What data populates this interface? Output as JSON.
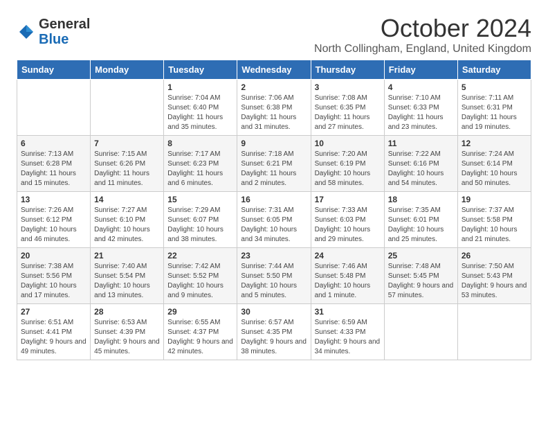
{
  "header": {
    "logo_general": "General",
    "logo_blue": "Blue",
    "month_title": "October 2024",
    "subtitle": "North Collingham, England, United Kingdom"
  },
  "weekdays": [
    "Sunday",
    "Monday",
    "Tuesday",
    "Wednesday",
    "Thursday",
    "Friday",
    "Saturday"
  ],
  "weeks": [
    [
      {
        "day": "",
        "sunrise": "",
        "sunset": "",
        "daylight": ""
      },
      {
        "day": "",
        "sunrise": "",
        "sunset": "",
        "daylight": ""
      },
      {
        "day": "1",
        "sunrise": "Sunrise: 7:04 AM",
        "sunset": "Sunset: 6:40 PM",
        "daylight": "Daylight: 11 hours and 35 minutes."
      },
      {
        "day": "2",
        "sunrise": "Sunrise: 7:06 AM",
        "sunset": "Sunset: 6:38 PM",
        "daylight": "Daylight: 11 hours and 31 minutes."
      },
      {
        "day": "3",
        "sunrise": "Sunrise: 7:08 AM",
        "sunset": "Sunset: 6:35 PM",
        "daylight": "Daylight: 11 hours and 27 minutes."
      },
      {
        "day": "4",
        "sunrise": "Sunrise: 7:10 AM",
        "sunset": "Sunset: 6:33 PM",
        "daylight": "Daylight: 11 hours and 23 minutes."
      },
      {
        "day": "5",
        "sunrise": "Sunrise: 7:11 AM",
        "sunset": "Sunset: 6:31 PM",
        "daylight": "Daylight: 11 hours and 19 minutes."
      }
    ],
    [
      {
        "day": "6",
        "sunrise": "Sunrise: 7:13 AM",
        "sunset": "Sunset: 6:28 PM",
        "daylight": "Daylight: 11 hours and 15 minutes."
      },
      {
        "day": "7",
        "sunrise": "Sunrise: 7:15 AM",
        "sunset": "Sunset: 6:26 PM",
        "daylight": "Daylight: 11 hours and 11 minutes."
      },
      {
        "day": "8",
        "sunrise": "Sunrise: 7:17 AM",
        "sunset": "Sunset: 6:23 PM",
        "daylight": "Daylight: 11 hours and 6 minutes."
      },
      {
        "day": "9",
        "sunrise": "Sunrise: 7:18 AM",
        "sunset": "Sunset: 6:21 PM",
        "daylight": "Daylight: 11 hours and 2 minutes."
      },
      {
        "day": "10",
        "sunrise": "Sunrise: 7:20 AM",
        "sunset": "Sunset: 6:19 PM",
        "daylight": "Daylight: 10 hours and 58 minutes."
      },
      {
        "day": "11",
        "sunrise": "Sunrise: 7:22 AM",
        "sunset": "Sunset: 6:16 PM",
        "daylight": "Daylight: 10 hours and 54 minutes."
      },
      {
        "day": "12",
        "sunrise": "Sunrise: 7:24 AM",
        "sunset": "Sunset: 6:14 PM",
        "daylight": "Daylight: 10 hours and 50 minutes."
      }
    ],
    [
      {
        "day": "13",
        "sunrise": "Sunrise: 7:26 AM",
        "sunset": "Sunset: 6:12 PM",
        "daylight": "Daylight: 10 hours and 46 minutes."
      },
      {
        "day": "14",
        "sunrise": "Sunrise: 7:27 AM",
        "sunset": "Sunset: 6:10 PM",
        "daylight": "Daylight: 10 hours and 42 minutes."
      },
      {
        "day": "15",
        "sunrise": "Sunrise: 7:29 AM",
        "sunset": "Sunset: 6:07 PM",
        "daylight": "Daylight: 10 hours and 38 minutes."
      },
      {
        "day": "16",
        "sunrise": "Sunrise: 7:31 AM",
        "sunset": "Sunset: 6:05 PM",
        "daylight": "Daylight: 10 hours and 34 minutes."
      },
      {
        "day": "17",
        "sunrise": "Sunrise: 7:33 AM",
        "sunset": "Sunset: 6:03 PM",
        "daylight": "Daylight: 10 hours and 29 minutes."
      },
      {
        "day": "18",
        "sunrise": "Sunrise: 7:35 AM",
        "sunset": "Sunset: 6:01 PM",
        "daylight": "Daylight: 10 hours and 25 minutes."
      },
      {
        "day": "19",
        "sunrise": "Sunrise: 7:37 AM",
        "sunset": "Sunset: 5:58 PM",
        "daylight": "Daylight: 10 hours and 21 minutes."
      }
    ],
    [
      {
        "day": "20",
        "sunrise": "Sunrise: 7:38 AM",
        "sunset": "Sunset: 5:56 PM",
        "daylight": "Daylight: 10 hours and 17 minutes."
      },
      {
        "day": "21",
        "sunrise": "Sunrise: 7:40 AM",
        "sunset": "Sunset: 5:54 PM",
        "daylight": "Daylight: 10 hours and 13 minutes."
      },
      {
        "day": "22",
        "sunrise": "Sunrise: 7:42 AM",
        "sunset": "Sunset: 5:52 PM",
        "daylight": "Daylight: 10 hours and 9 minutes."
      },
      {
        "day": "23",
        "sunrise": "Sunrise: 7:44 AM",
        "sunset": "Sunset: 5:50 PM",
        "daylight": "Daylight: 10 hours and 5 minutes."
      },
      {
        "day": "24",
        "sunrise": "Sunrise: 7:46 AM",
        "sunset": "Sunset: 5:48 PM",
        "daylight": "Daylight: 10 hours and 1 minute."
      },
      {
        "day": "25",
        "sunrise": "Sunrise: 7:48 AM",
        "sunset": "Sunset: 5:45 PM",
        "daylight": "Daylight: 9 hours and 57 minutes."
      },
      {
        "day": "26",
        "sunrise": "Sunrise: 7:50 AM",
        "sunset": "Sunset: 5:43 PM",
        "daylight": "Daylight: 9 hours and 53 minutes."
      }
    ],
    [
      {
        "day": "27",
        "sunrise": "Sunrise: 6:51 AM",
        "sunset": "Sunset: 4:41 PM",
        "daylight": "Daylight: 9 hours and 49 minutes."
      },
      {
        "day": "28",
        "sunrise": "Sunrise: 6:53 AM",
        "sunset": "Sunset: 4:39 PM",
        "daylight": "Daylight: 9 hours and 45 minutes."
      },
      {
        "day": "29",
        "sunrise": "Sunrise: 6:55 AM",
        "sunset": "Sunset: 4:37 PM",
        "daylight": "Daylight: 9 hours and 42 minutes."
      },
      {
        "day": "30",
        "sunrise": "Sunrise: 6:57 AM",
        "sunset": "Sunset: 4:35 PM",
        "daylight": "Daylight: 9 hours and 38 minutes."
      },
      {
        "day": "31",
        "sunrise": "Sunrise: 6:59 AM",
        "sunset": "Sunset: 4:33 PM",
        "daylight": "Daylight: 9 hours and 34 minutes."
      },
      {
        "day": "",
        "sunrise": "",
        "sunset": "",
        "daylight": ""
      },
      {
        "day": "",
        "sunrise": "",
        "sunset": "",
        "daylight": ""
      }
    ]
  ]
}
